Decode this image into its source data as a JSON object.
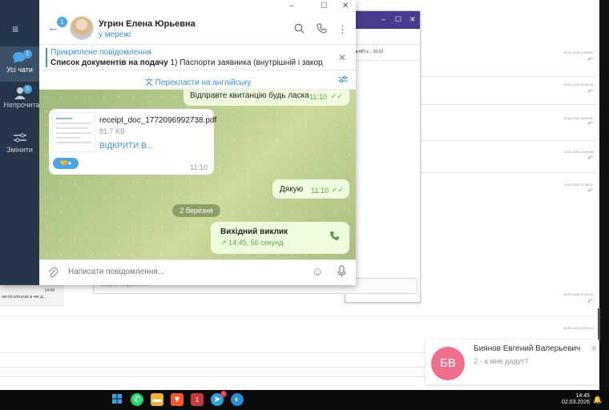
{
  "background": {
    "timestamps": [
      "26.02.2026 14:50:52",
      "23.02.2026 15:48:16",
      "20.02.2026 15:09:52",
      "13.02.2026 15:08:48",
      "11.02.2026 11:48:02",
      "09.02.2026 15:09:04",
      "05.02.2026 15:09:14"
    ],
    "left_item": {
      "time": "14:44",
      "desc": "оні по клієнтах в чат д..."
    },
    "win2_row1": "29",
    "win2_row2": "еху в МП е... 10.02",
    "win2_input_placeholder": "Введіть повідомлення"
  },
  "telegram": {
    "sidebar": {
      "items": [
        {
          "label": "Усі чати",
          "badge": "1"
        },
        {
          "label": "Непрочитано",
          "badge": "1"
        },
        {
          "label": "Змінити"
        }
      ]
    },
    "header": {
      "back_badge": "1",
      "contact_name": "Угрин Елена Юрьевна",
      "contact_status": "у мережі"
    },
    "pinned": {
      "title": "Прикріплене повідомлення",
      "text_bold": "Список документів на подачу",
      "text_rest": " 1) Паспорти заявника (внутрішній і закордо..."
    },
    "translate": {
      "label": "Перекласти на англійську"
    },
    "messages": {
      "m1_text": "Відправте квитанцію будь ласка",
      "m1_time": "11:10",
      "file_name": "receipt_doc_1772096992738.pdf",
      "file_size": "81.7 KB",
      "file_open": "ВІДКРИТИ В...",
      "file_time": "11:10",
      "m2_text": "Дякую",
      "m2_time": "11:10",
      "date_separator": "2 березня",
      "call_title": "Вихідний виклик",
      "call_sub": "14:45, 56 секунд"
    },
    "composer": {
      "placeholder": "Написати повідомлення..."
    }
  },
  "notification": {
    "initials": "БВ",
    "name": "Биянов Евгений Валерьевич",
    "message": "2 - а мне дадут?"
  },
  "taskbar": {
    "time": "14:45",
    "date": "02.03.2026",
    "telegram_badge": "1",
    "app_badge": "1"
  }
}
